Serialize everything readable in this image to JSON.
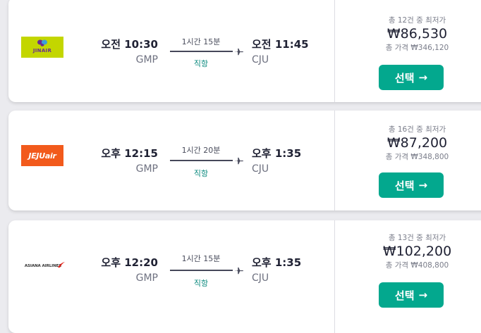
{
  "flights": [
    {
      "airline_logo": "JINAIR",
      "dep_time": "오전 10:30",
      "dep_code": "GMP",
      "duration": "1시간 15분",
      "stops": "직항",
      "arr_time": "오전 11:45",
      "arr_code": "CJU",
      "price_label": "총 12건 중 최저가",
      "price": "₩86,530",
      "total_label": "총 가격 ₩346,120",
      "select_label": "선택"
    },
    {
      "airline_logo": "JEJUair",
      "dep_time": "오후 12:15",
      "dep_code": "GMP",
      "duration": "1시간 20분",
      "stops": "직항",
      "arr_time": "오후 1:35",
      "arr_code": "CJU",
      "price_label": "총 16건 중 최저가",
      "price": "₩87,200",
      "total_label": "총 가격 ₩348,800",
      "select_label": "선택"
    },
    {
      "airline_logo": "ASIANA AIRLINES",
      "dep_time": "오후 12:20",
      "dep_code": "GMP",
      "duration": "1시간 15분",
      "stops": "직항",
      "arr_time": "오후 1:35",
      "arr_code": "CJU",
      "price_label": "총 13건 중 최저가",
      "price": "₩102,200",
      "total_label": "총 가격 ₩408,800",
      "select_label": "선택"
    }
  ],
  "icons": {
    "plane": "plane-icon",
    "arrow": "arrow-right-icon"
  },
  "colors": {
    "accent": "#03a88e",
    "stop_text": "#0b8a7e",
    "jinair_logo": "#c3d600",
    "jejuair_logo": "#f25a1c",
    "asiana_mark": "#e2231a"
  }
}
